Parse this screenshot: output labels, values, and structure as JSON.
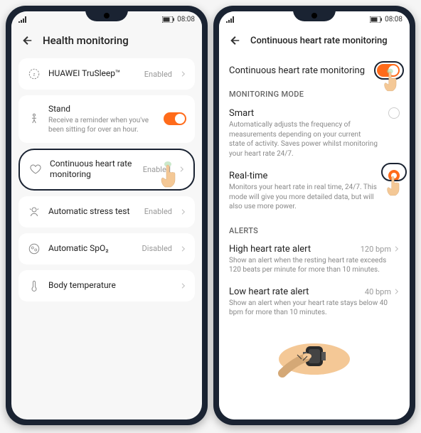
{
  "status": {
    "time": "08:08"
  },
  "left": {
    "title": "Health monitoring",
    "items": [
      {
        "icon": "sleep",
        "title": "HUAWEI TruSleep™",
        "sub": "",
        "status": "Enabled",
        "toggle": null
      },
      {
        "icon": "stand",
        "title": "Stand",
        "sub": "Receive a reminder when you've been sitting for over an hour.",
        "status": "",
        "toggle": true
      },
      {
        "icon": "heart",
        "title": "Continuous heart rate monitoring",
        "sub": "",
        "status": "Enabled",
        "toggle": null,
        "highlighted": true
      },
      {
        "icon": "stress",
        "title": "Automatic stress test",
        "sub": "",
        "status": "Enabled",
        "toggle": null
      },
      {
        "icon": "spo2",
        "title": "Automatic SpO₂",
        "sub": "",
        "status": "Disabled",
        "toggle": null
      },
      {
        "icon": "temp",
        "title": "Body temperature",
        "sub": "",
        "status": "",
        "toggle": null
      }
    ]
  },
  "right": {
    "title": "Continuous heart rate monitoring",
    "toggle_label": "Continuous heart rate monitoring",
    "toggle_on": true,
    "section_mode": "MONITORING MODE",
    "modes": [
      {
        "title": "Smart",
        "desc": "Automatically adjusts the frequency of measurements depending on your current state of activity. Saves power whilst monitoring your heart rate 24/7.",
        "selected": false
      },
      {
        "title": "Real-time",
        "desc": "Monitors your heart rate in real time, 24/7. This mode will give you more detailed data, but will also use more power.",
        "selected": true
      }
    ],
    "section_alerts": "ALERTS",
    "alerts": [
      {
        "title": "High heart rate alert",
        "value": "120 bpm",
        "desc": "Show an alert when the resting heart rate exceeds 120 beats per minute for more than 10 minutes."
      },
      {
        "title": "Low heart rate alert",
        "value": "40 bpm",
        "desc": "Show an alert when your heart rate stays below 40 bpm for more than 10 minutes."
      }
    ]
  }
}
